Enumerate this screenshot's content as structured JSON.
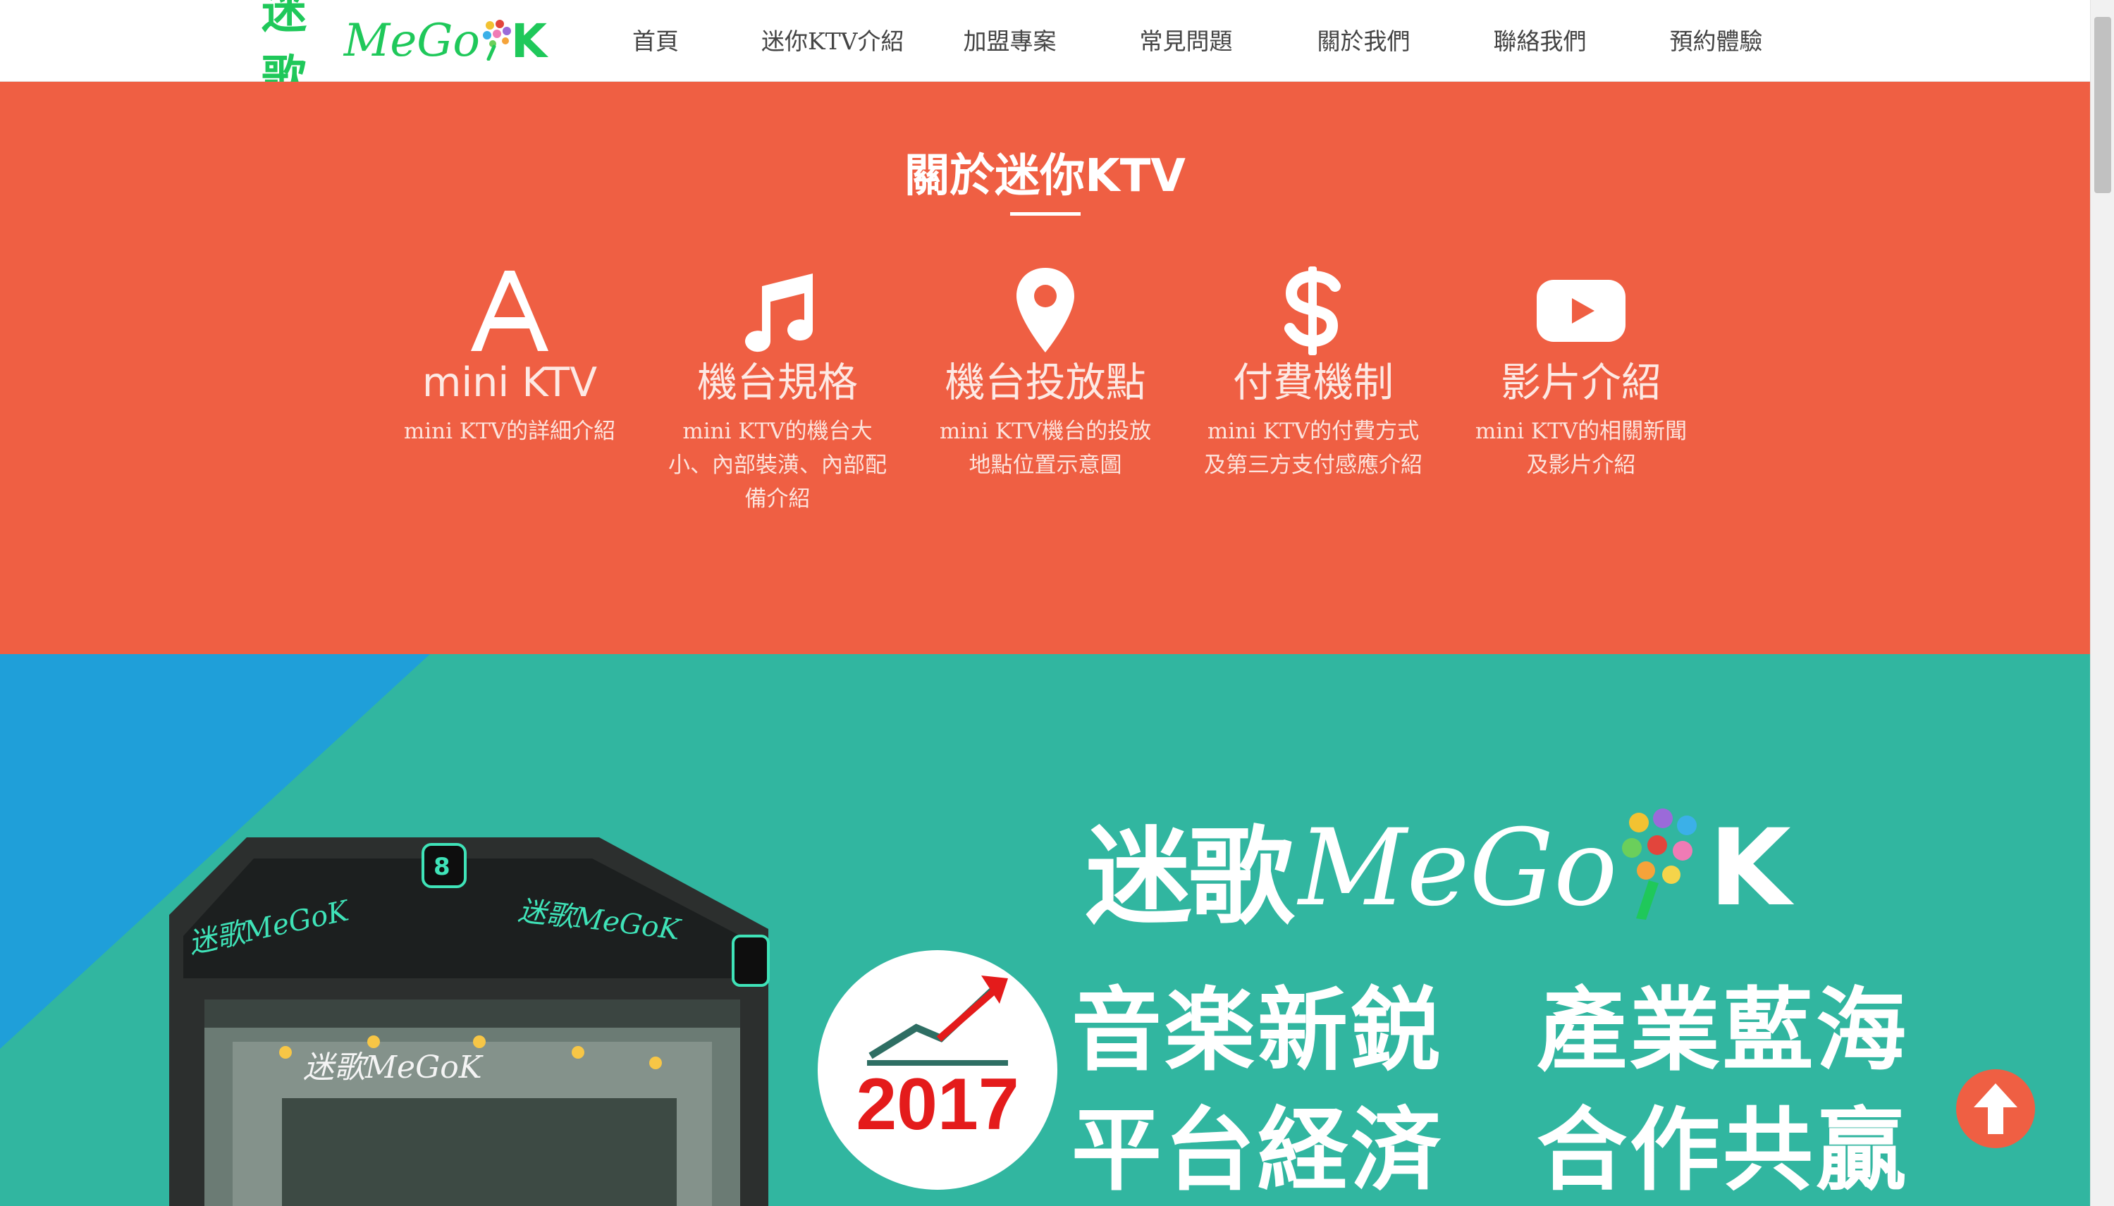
{
  "brand": {
    "logo_cjk": "迷歌",
    "logo_latin": "MeGo",
    "logo_k": "K"
  },
  "nav": {
    "items": [
      {
        "label": "首頁"
      },
      {
        "label": "迷你KTV介紹"
      },
      {
        "label": "加盟專案"
      },
      {
        "label": "常見問題"
      },
      {
        "label": "關於我們"
      },
      {
        "label": "聯絡我們"
      },
      {
        "label": "預約體驗"
      }
    ]
  },
  "about": {
    "title": "關於迷你KTV",
    "features": [
      {
        "icon": "font-icon",
        "title": "mini KTV",
        "desc": "mini KTV的詳細介紹"
      },
      {
        "icon": "music-note-icon",
        "title": "機台規格",
        "desc": "mini KTV的機台大小、內部裝潢、內部配備介紹"
      },
      {
        "icon": "map-marker-icon",
        "title": "機台投放點",
        "desc": "mini KTV機台的投放地點位置示意圖"
      },
      {
        "icon": "dollar-icon",
        "title": "付費機制",
        "desc": "mini KTV的付費方式及第三方支付感應介紹"
      },
      {
        "icon": "youtube-icon",
        "title": "影片介紹",
        "desc": "mini KTV的相關新聞及影片介紹"
      }
    ]
  },
  "banner": {
    "logo_cjk": "迷歌",
    "logo_latin": "MeGo",
    "logo_k": "K",
    "year": "2017",
    "slogan_line1_a": "音楽新鋭",
    "slogan_line1_b": "產業藍海",
    "slogan_line2_a": "平台経済",
    "slogan_line2_b": "合作共贏",
    "machine_logo_text": "迷歌MeGo",
    "machine_logo_k": "K",
    "machine_badge": "8"
  },
  "back_to_top": {
    "icon": "arrow-up-icon"
  },
  "colors": {
    "brand_green": "#1fc85a",
    "about_bg": "#ef5f43",
    "banner_teal": "#31b6a0",
    "banner_blue": "#1f9fd9",
    "year_red": "#e41b1b"
  }
}
